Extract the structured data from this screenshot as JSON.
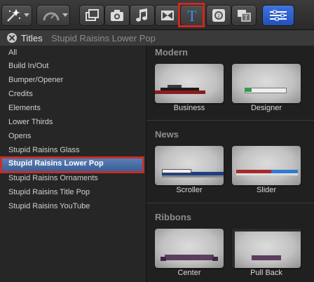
{
  "toolbar": {
    "buttons": [
      {
        "name": "magic-wand-icon"
      },
      {
        "name": "speedometer-icon"
      },
      {
        "name": "clip-stack-icon"
      },
      {
        "name": "camera-icon"
      },
      {
        "name": "music-note-icon"
      },
      {
        "name": "transition-icon"
      },
      {
        "name": "titles-icon",
        "glyph": "T",
        "selected": true
      },
      {
        "name": "generator-icon"
      },
      {
        "name": "themes-icon"
      },
      {
        "name": "inspector-icon"
      }
    ]
  },
  "header": {
    "title": "Titles",
    "search_text": "Stupid Raisins Lower Pop"
  },
  "sidebar": {
    "items": [
      {
        "label": "All"
      },
      {
        "label": "Build In/Out"
      },
      {
        "label": "Bumper/Opener"
      },
      {
        "label": "Credits"
      },
      {
        "label": "Elements"
      },
      {
        "label": "Lower Thirds"
      },
      {
        "label": "Opens"
      },
      {
        "label": "Stupid Raisins Glass"
      },
      {
        "label": "Stupid Raisins Lower Pop",
        "selected": true
      },
      {
        "label": "Stupid Raisins Ornaments"
      },
      {
        "label": "Stupid Raisins Title Pop"
      },
      {
        "label": "Stupid Raisins YouTube"
      }
    ]
  },
  "sections": [
    {
      "title": "Modern",
      "items": [
        {
          "label": "Business"
        },
        {
          "label": "Designer"
        }
      ]
    },
    {
      "title": "News",
      "items": [
        {
          "label": "Scroller"
        },
        {
          "label": "Slider"
        }
      ]
    },
    {
      "title": "Ribbons",
      "items": [
        {
          "label": "Center"
        },
        {
          "label": "Pull Back"
        }
      ]
    }
  ],
  "colors": {
    "highlight_red": "#d2261f",
    "selection_blue": "#3a5f98",
    "inspector_blue": "#2f5fd0"
  }
}
